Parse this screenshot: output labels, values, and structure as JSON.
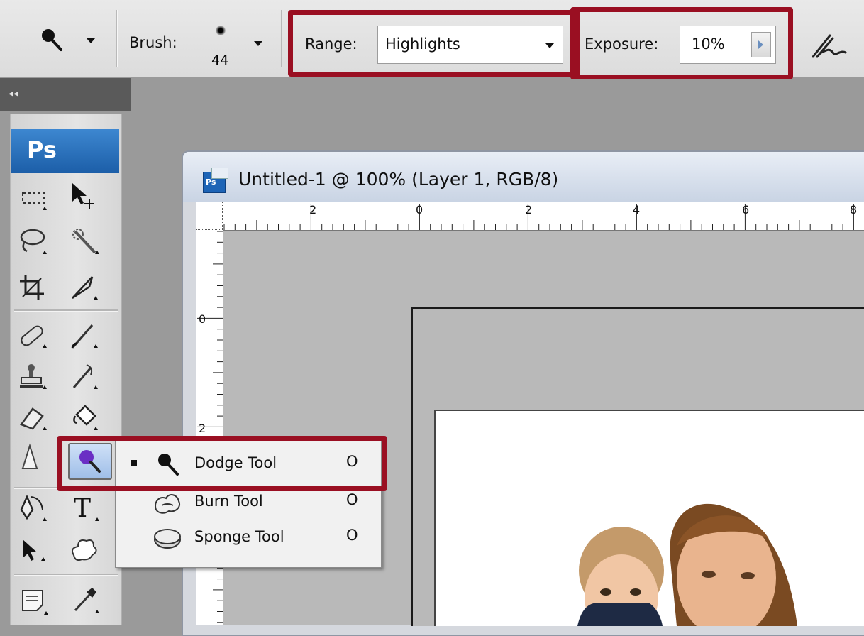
{
  "options_bar": {
    "brush_label": "Brush:",
    "brush_size": "44",
    "range_label": "Range:",
    "range_value": "Highlights",
    "exposure_label": "Exposure:",
    "exposure_value": "10%"
  },
  "tools_panel": {
    "collapse_label": "◂◂",
    "logo": "Ps"
  },
  "document": {
    "title": "Untitled-1 @ 100% (Layer 1, RGB/8)",
    "hruler_ticks": [
      "2",
      "0",
      "2",
      "4",
      "6",
      "8"
    ],
    "vruler_ticks": [
      "0",
      "2"
    ]
  },
  "flyout_menu": {
    "items": [
      {
        "label": "Dodge Tool",
        "shortcut": "O",
        "active": true
      },
      {
        "label": "Burn Tool",
        "shortcut": "O",
        "active": false
      },
      {
        "label": "Sponge Tool",
        "shortcut": "O",
        "active": false
      }
    ]
  },
  "colors": {
    "highlight_red": "#9a0f22",
    "ps_blue": "#1c5ea8"
  }
}
